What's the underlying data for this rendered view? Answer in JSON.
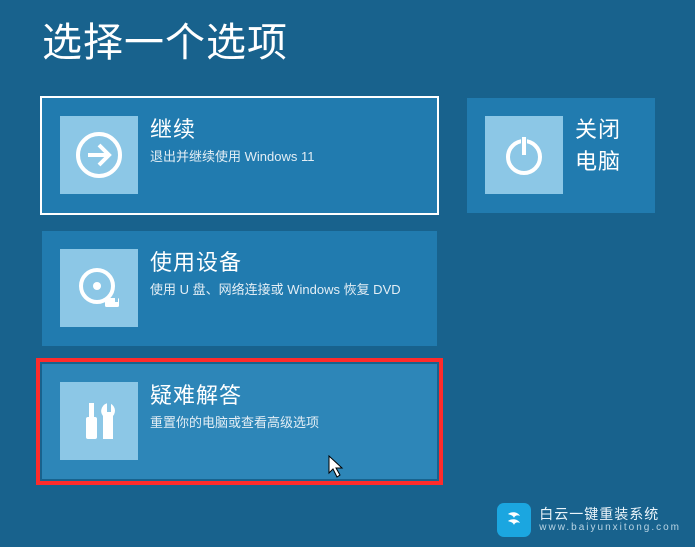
{
  "title": "选择一个选项",
  "options": {
    "continue": {
      "heading": "继续",
      "sub": "退出并继续使用 Windows 11"
    },
    "use_device": {
      "heading": "使用设备",
      "sub": "使用 U 盘、网络连接或 Windows 恢复 DVD"
    },
    "troubleshoot": {
      "heading": "疑难解答",
      "sub": "重置你的电脑或查看高级选项"
    },
    "shutdown": {
      "heading": "关闭电脑"
    }
  },
  "watermark": {
    "brand": "白云一键重装系统",
    "site": "www.baiyunxitong.com"
  },
  "colors": {
    "bg": "#18628d",
    "tile": "#217baf",
    "tile_hover": "#2d86b8",
    "tile_icon_bg": "#8cc7e6",
    "annotation": "#ff2b2b",
    "wm_badge": "#1ba6e0"
  }
}
